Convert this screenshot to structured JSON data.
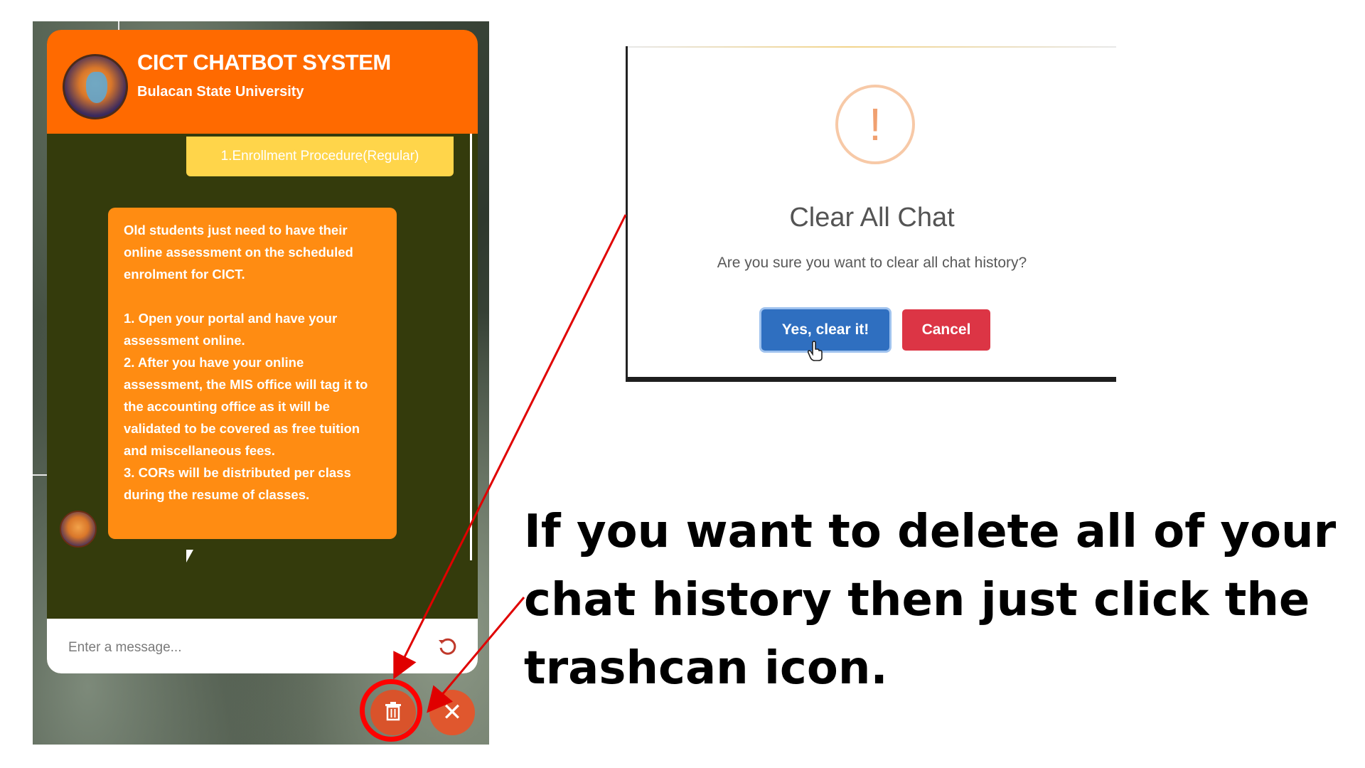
{
  "chat": {
    "header_title": "CICT CHATBOT SYSTEM",
    "header_subtitle": "Bulacan State University",
    "user_message": "1.Enrollment Procedure(Regular)",
    "bot_message": "Old students just need to have their online assessment on the scheduled enrolment for CICT.\n\n1. Open your portal and have your assessment online.\n2. After you have your online assessment, the MIS office will tag it to the accounting office as it will be validated to be covered as free tuition and miscellaneous fees.\n3. CORs will be distributed per class during the resume of classes.",
    "input_placeholder": "Enter a message...",
    "refresh_icon": "refresh-icon",
    "trash_icon": "trash-icon",
    "close_symbol": "✕"
  },
  "dialog": {
    "icon_symbol": "!",
    "title": "Clear All Chat",
    "text": "Are you sure you want to clear all chat history?",
    "confirm_label": "Yes, clear it!",
    "cancel_label": "Cancel"
  },
  "instruction": {
    "text": "If you want to delete all of your chat history then just click the trashcan icon."
  },
  "colors": {
    "header": "#ff6a00",
    "chat_bg": "#343b0c",
    "bot_bubble": "#ff8c12",
    "user_bubble": "#ffd54a",
    "confirm_button": "#2f6fc0",
    "cancel_button": "#dc3545",
    "annotation": "#e00000"
  }
}
